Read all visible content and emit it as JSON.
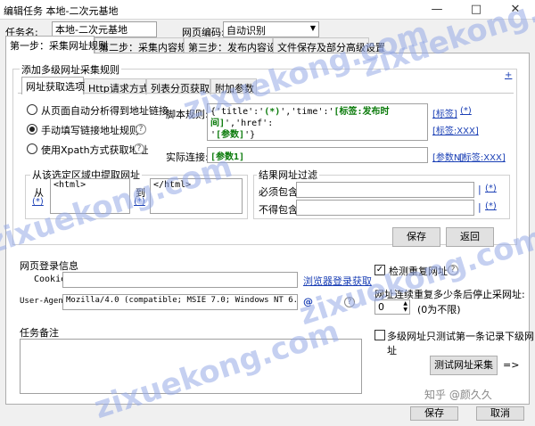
{
  "window": {
    "title": "编辑任务 本地-二次元基地",
    "minimize": "—",
    "maximize": "□",
    "close": "✕"
  },
  "header": {
    "task_name_label": "任务名:",
    "task_name_value": "本地-二次元基地",
    "encoding_label": "网页编码:",
    "encoding_value": "自动识别"
  },
  "main_tabs": [
    "第一步：采集网址规则",
    "第二步：采集内容规则",
    "第三步：发布内容设置",
    "文件保存及部分高级设置"
  ],
  "multi_level_label": "添加多级网址采集规则",
  "sub_tabs": [
    "网址获取选项",
    "Http请求方式",
    "列表分页获取",
    "附加参数"
  ],
  "radios": [
    {
      "label": "从页面自动分析得到地址链接",
      "checked": false
    },
    {
      "label": "手动填写链接地址规则",
      "checked": true
    },
    {
      "label": "使用Xpath方式获取地址",
      "checked": false
    }
  ],
  "script_rule": {
    "label": "脚本规则:",
    "line1a": "{'title':'",
    "line1b": "(*)",
    "line1c": "','time':'",
    "line1d": "[标签:发布时间]",
    "line1e": "','href':",
    "line2a": "'",
    "line2b": "[参数]",
    "line2c": "'}",
    "link_tag": "[标签]",
    "link_star": "(*)",
    "link_tag_xxx": "[标签:XXX]"
  },
  "actual_link": {
    "label": "实际连接:",
    "value": "[参数1]",
    "link_param_n": "[参数N]",
    "link_tag_xxx": "[标签:XXX]"
  },
  "extract_region": {
    "title": "从该选定区域中提取网址",
    "from": "从",
    "to": "到",
    "star": "(*)",
    "start_value": "<html>",
    "end_value": "</html>"
  },
  "url_filter": {
    "title": "结果网址过滤",
    "must_label": "必须包含",
    "not_label": "不得包含",
    "sep": "|",
    "star": "(*)"
  },
  "buttons": {
    "save": "保存",
    "back": "返回",
    "test": "测试网址采集",
    "arrow": "=>",
    "ok": "保存",
    "cancel": "取消"
  },
  "login": {
    "title": "网页登录信息",
    "cookie_label": "Cookie",
    "browser_login": "浏览器登录获取",
    "ua_label": "User-Agent",
    "ua_value": "Mozilla/4.0 (compatible; MSIE 7.0; Windows NT 6.2; WOW64;"
  },
  "dup": {
    "label": "检测重复网址",
    "checked": true
  },
  "stop": {
    "label": "网址连续重复多少条后停止采网址:",
    "value": "0",
    "note": "(0为不限)"
  },
  "notes": {
    "title": "任务备注"
  },
  "multi_test": {
    "label": "多级网址只测试第一条记录下级网址",
    "checked": false
  },
  "help_glyph": "?",
  "check_glyph": "✓",
  "watermarks": [
    "zixuekong.com",
    "zixuekong.com",
    "zixuekong.com",
    "zixuekong.com",
    "zixuekong.com"
  ],
  "credit": "知乎 @颜久久"
}
